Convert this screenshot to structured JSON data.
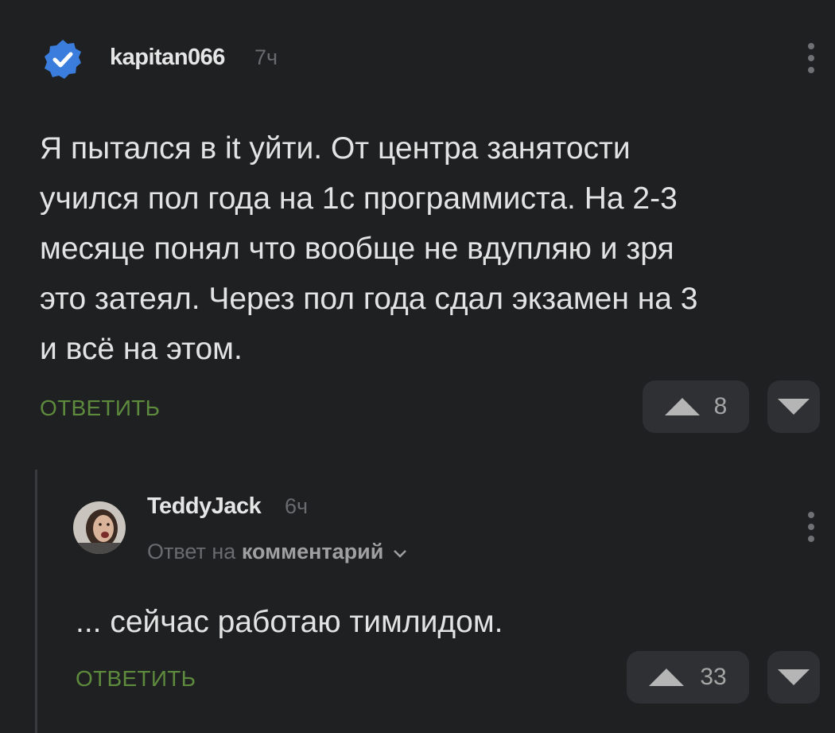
{
  "comment": {
    "author": "kapitan066",
    "time": "7ч",
    "lines": [
      "Я пытался в it уйти. От центра занятости",
      "учился пол года на 1с программиста. На 2-3",
      "месяце понял что вообще не вдупляю и зря",
      "это затеял. Через пол года сдал экзамен на 3",
      "и всё на этом."
    ],
    "reply_label": "ОТВЕТИТЬ",
    "votes": "8"
  },
  "reply": {
    "author": "TeddyJack",
    "time": "6ч",
    "reply_to_prefix": "Ответ на",
    "reply_to_target": "комментарий",
    "text": "... сейчас работаю тимлидом.",
    "reply_label": "ОТВЕТИТЬ",
    "votes": "33"
  },
  "colors": {
    "background": "#1f2022",
    "accent_green": "#5d8a3c",
    "verified_blue": "#3b7ddd"
  }
}
